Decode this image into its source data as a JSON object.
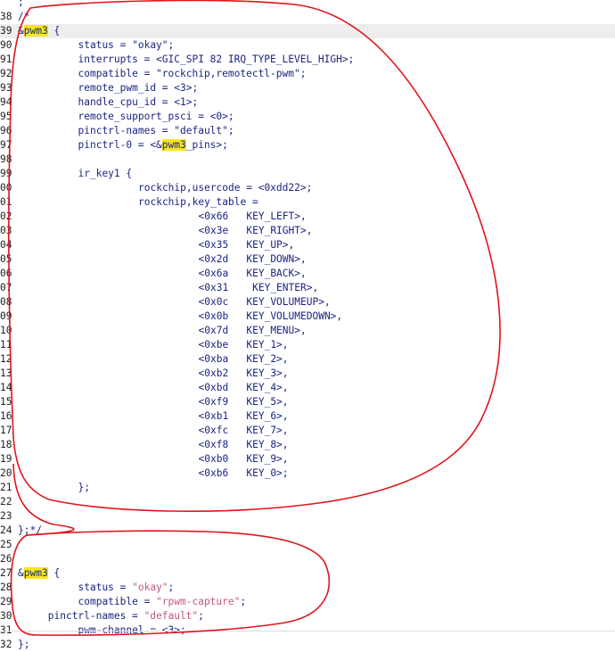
{
  "editor": {
    "lines": [
      {
        "no": "",
        "text": ";",
        "indent": 2
      },
      {
        "no": "38",
        "text": "/*",
        "indent": 2
      },
      {
        "no": "39",
        "pre": "&",
        "hl": "pwm3",
        "post": " {",
        "indent": 2,
        "current": true
      },
      {
        "no": "90",
        "text": "status = \"okay\";",
        "indent": 12
      },
      {
        "no": "91",
        "text": "interrupts = <GIC_SPI 82 IRQ_TYPE_LEVEL_HIGH>;",
        "indent": 12
      },
      {
        "no": "92",
        "text": "compatible = \"rockchip,remotectl-pwm\";",
        "indent": 12
      },
      {
        "no": "93",
        "text": "remote_pwm_id = <3>;",
        "indent": 12
      },
      {
        "no": "94",
        "text": "handle_cpu_id = <1>;",
        "indent": 12
      },
      {
        "no": "95",
        "text": "remote_support_psci = <0>;",
        "indent": 12
      },
      {
        "no": "96",
        "text": "pinctrl-names = \"default\";",
        "indent": 12
      },
      {
        "no": "97",
        "pre": "pinctrl-0 = <&",
        "hl": "pwm3",
        "post": "_pins>;",
        "indent": 12
      },
      {
        "no": "98",
        "text": "",
        "indent": 12
      },
      {
        "no": "99",
        "text": "ir_key1 {",
        "indent": 12
      },
      {
        "no": "00",
        "text": "rockchip,usercode = <0xdd22>;",
        "indent": 22
      },
      {
        "no": "01",
        "text": "rockchip,key_table =",
        "indent": 22
      },
      {
        "no": "02",
        "text": "<0x66   KEY_LEFT>,",
        "indent": 32
      },
      {
        "no": "03",
        "text": "<0x3e   KEY_RIGHT>,",
        "indent": 32
      },
      {
        "no": "04",
        "text": "<0x35   KEY_UP>,",
        "indent": 32
      },
      {
        "no": "05",
        "text": "<0x2d   KEY_DOWN>,",
        "indent": 32
      },
      {
        "no": "06",
        "text": "<0x6a   KEY_BACK>,",
        "indent": 32
      },
      {
        "no": "07",
        "text": "<0x31    KEY_ENTER>,",
        "indent": 32
      },
      {
        "no": "08",
        "text": "<0x0c   KEY_VOLUMEUP>,",
        "indent": 32
      },
      {
        "no": "09",
        "text": "<0x0b   KEY_VOLUMEDOWN>,",
        "indent": 32
      },
      {
        "no": "10",
        "text": "<0x7d   KEY_MENU>,",
        "indent": 32
      },
      {
        "no": "11",
        "text": "<0xbe   KEY_1>,",
        "indent": 32
      },
      {
        "no": "12",
        "text": "<0xba   KEY_2>,",
        "indent": 32
      },
      {
        "no": "13",
        "text": "<0xb2   KEY_3>,",
        "indent": 32
      },
      {
        "no": "14",
        "text": "<0xbd   KEY_4>,",
        "indent": 32
      },
      {
        "no": "15",
        "text": "<0xf9   KEY_5>,",
        "indent": 32
      },
      {
        "no": "16",
        "text": "<0xb1   KEY_6>,",
        "indent": 32
      },
      {
        "no": "17",
        "text": "<0xfc   KEY_7>,",
        "indent": 32
      },
      {
        "no": "18",
        "text": "<0xf8   KEY_8>,",
        "indent": 32
      },
      {
        "no": "19",
        "text": "<0xb0   KEY_9>,",
        "indent": 32
      },
      {
        "no": "20",
        "text": "<0xb6   KEY_0>;",
        "indent": 32
      },
      {
        "no": "21",
        "text": "};",
        "indent": 12
      },
      {
        "no": "22",
        "text": "",
        "indent": 2
      },
      {
        "no": "23",
        "text": "",
        "indent": 2
      },
      {
        "no": "24",
        "text": "};*/",
        "indent": 2
      },
      {
        "no": "25",
        "text": "",
        "indent": 2
      },
      {
        "no": "26",
        "text": "",
        "indent": 2
      },
      {
        "no": "27",
        "pre": "&",
        "hl": "pwm3",
        "post": " {",
        "indent": 2
      },
      {
        "no": "28",
        "pre": "status = ",
        "str": "\"okay\"",
        "post": ";",
        "indent": 12
      },
      {
        "no": "29",
        "pre": "compatible = ",
        "str": "\"rpwm-capture\"",
        "post": ";",
        "indent": 12
      },
      {
        "no": "30",
        "pre": "pinctrl-names = ",
        "str": "\"default\"",
        "post": ";",
        "indent": 7
      },
      {
        "no": "31",
        "text": "pwm-channel = <3>;",
        "indent": 12
      },
      {
        "no": "32",
        "text": "};",
        "indent": 2
      }
    ]
  },
  "colors": {
    "code_text": "#1a2580",
    "string_text": "#c0587a",
    "search_highlight": "#f5e61c",
    "current_line": "#eeeeee",
    "annotation_ink": "#e0141c"
  }
}
